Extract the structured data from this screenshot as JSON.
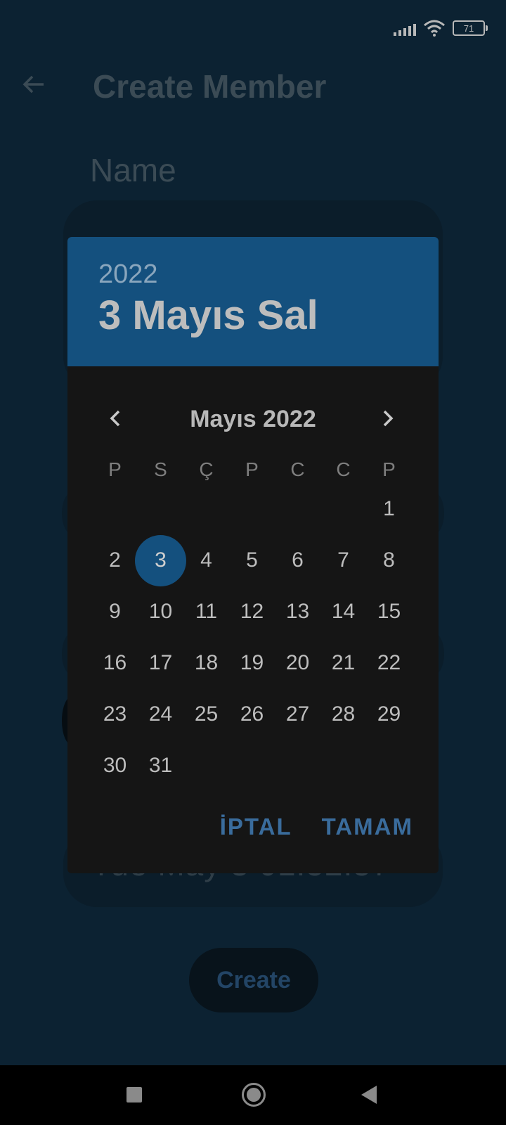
{
  "status_bar": {
    "battery": "71"
  },
  "app": {
    "title": "Create Member",
    "name_label": "Name",
    "date_value": "Tue May  3 01:52:57",
    "create_label": "Create"
  },
  "date_picker": {
    "header_year": "2022",
    "header_date": "3 Mayıs Sal",
    "month_title": "Mayıs 2022",
    "weekdays": [
      "P",
      "S",
      "Ç",
      "P",
      "C",
      "C",
      "P"
    ],
    "weeks": [
      [
        "",
        "",
        "",
        "",
        "",
        "",
        "1"
      ],
      [
        "2",
        "3",
        "4",
        "5",
        "6",
        "7",
        "8"
      ],
      [
        "9",
        "10",
        "11",
        "12",
        "13",
        "14",
        "15"
      ],
      [
        "16",
        "17",
        "18",
        "19",
        "20",
        "21",
        "22"
      ],
      [
        "23",
        "24",
        "25",
        "26",
        "27",
        "28",
        "29"
      ],
      [
        "30",
        "31",
        "",
        "",
        "",
        "",
        ""
      ]
    ],
    "selected_day": "3",
    "cancel_label": "İPTAL",
    "ok_label": "TAMAM"
  },
  "colors": {
    "accent": "#14507e",
    "background": "#0c2232",
    "dialog": "#151515"
  }
}
